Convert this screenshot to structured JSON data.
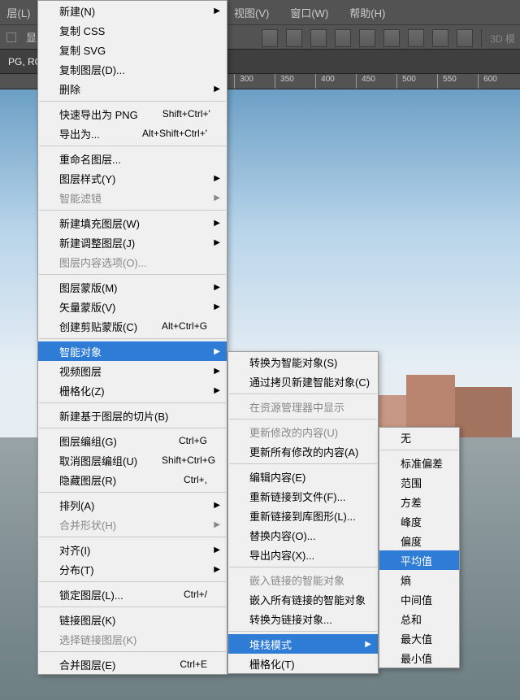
{
  "menubar": {
    "layer": "层(L)",
    "view": "视图(V)",
    "window": "窗口(W)",
    "help": "帮助(H)"
  },
  "toolbar": {
    "show": "显",
    "mode3d": "3D 模"
  },
  "tab": "PG, RG",
  "ruler": [
    "300",
    "350",
    "400",
    "450",
    "500",
    "550",
    "600"
  ],
  "lvl1": {
    "new": "新建(N)",
    "copyCss": "复制 CSS",
    "copySvg": "复制 SVG",
    "dupLayer": "复制图层(D)...",
    "delete": "删除",
    "quickExport": "快速导出为 PNG",
    "quickExportK": "Shift+Ctrl+'",
    "exportAs": "导出为...",
    "exportAsK": "Alt+Shift+Ctrl+'",
    "rename": "重命名图层...",
    "layerStyle": "图层样式(Y)",
    "smartFilter": "智能滤镜",
    "newFill": "新建填充图层(W)",
    "newAdjust": "新建调整图层(J)",
    "layerContent": "图层内容选项(O)...",
    "layerMask": "图层蒙版(M)",
    "vectorMask": "矢量蒙版(V)",
    "createClip": "创建剪贴蒙版(C)",
    "createClipK": "Alt+Ctrl+G",
    "smartObject": "智能对象",
    "videoLayer": "视频图层",
    "rasterize": "栅格化(Z)",
    "newSlice": "新建基于图层的切片(B)",
    "groupLayers": "图层编组(G)",
    "groupLayersK": "Ctrl+G",
    "ungroup": "取消图层编组(U)",
    "ungroupK": "Shift+Ctrl+G",
    "hideLayers": "隐藏图层(R)",
    "hideLayersK": "Ctrl+,",
    "arrange": "排列(A)",
    "combine": "合并形状(H)",
    "align": "对齐(I)",
    "distribute": "分布(T)",
    "lock": "锁定图层(L)...",
    "lockK": "Ctrl+/",
    "link": "链接图层(K)",
    "selectLinked": "选择链接图层(K)",
    "mergeLayers": "合并图层(E)",
    "mergeLayersK": "Ctrl+E"
  },
  "lvl2": {
    "convertSmart": "转换为智能对象(S)",
    "newViaCopy": "通过拷贝新建智能对象(C)",
    "revealExplorer": "在资源管理器中显示",
    "updateMod": "更新修改的内容(U)",
    "updateAll": "更新所有修改的内容(A)",
    "editContents": "编辑内容(E)",
    "relinkFile": "重新链接到文件(F)...",
    "relinkLib": "重新链接到库图形(L)...",
    "replaceContents": "替换内容(O)...",
    "exportContents": "导出内容(X)...",
    "embedLinked": "嵌入链接的智能对象",
    "embedAll": "嵌入所有链接的智能对象",
    "convertLinked": "转换为链接对象...",
    "stackMode": "堆栈模式",
    "rasterize": "栅格化(T)"
  },
  "lvl3": {
    "none": "无",
    "stddev": "标准偏差",
    "range": "范围",
    "variance": "方差",
    "kurtosis": "峰度",
    "skewness": "偏度",
    "mean": "平均值",
    "entropy": "熵",
    "median": "中间值",
    "sum": "总和",
    "max": "最大值",
    "min": "最小值"
  }
}
